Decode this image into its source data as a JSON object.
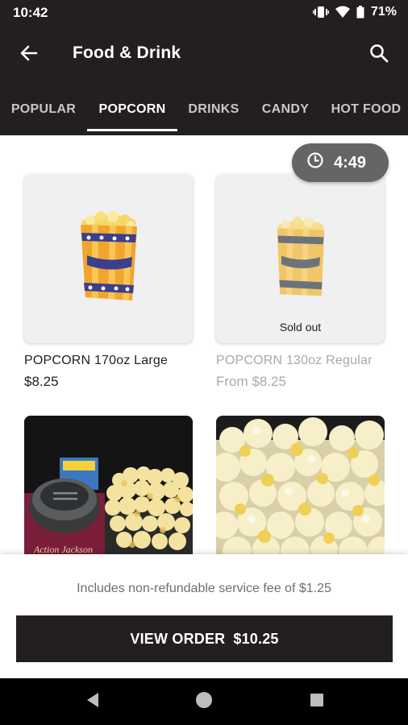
{
  "status_bar": {
    "time": "10:42",
    "battery": "71%"
  },
  "header": {
    "title": "Food & Drink",
    "back_icon": "arrow-left-icon",
    "search_icon": "search-icon"
  },
  "tabs": [
    {
      "label": "POPULAR",
      "active": false
    },
    {
      "label": "POPCORN",
      "active": true
    },
    {
      "label": "DRINKS",
      "active": false
    },
    {
      "label": "CANDY",
      "active": false
    },
    {
      "label": "HOT FOOD",
      "active": false
    }
  ],
  "timer": {
    "icon": "clock-icon",
    "value": "4:49"
  },
  "items": [
    {
      "name": "POPCORN 170oz Large",
      "price": "$8.25",
      "sold_out": false
    },
    {
      "name": "POPCORN 130oz Regular",
      "price": "From $8.25",
      "sold_out": true,
      "sold_out_label": "Sold out"
    }
  ],
  "photo_items": [
    {
      "image": "popcorn-combo-photo",
      "box_text": "Action Jackson"
    },
    {
      "image": "popcorn-closeup-photo"
    }
  ],
  "footer": {
    "fee_text": "Includes non-refundable service fee of $1.25",
    "button_label": "VIEW ORDER",
    "button_total": "$10.25"
  },
  "colors": {
    "dark": "#231f1f",
    "timer_bg": "#656565",
    "popcorn_bag": "#f2a52c",
    "popcorn_stripe": "#3a3f8f"
  }
}
